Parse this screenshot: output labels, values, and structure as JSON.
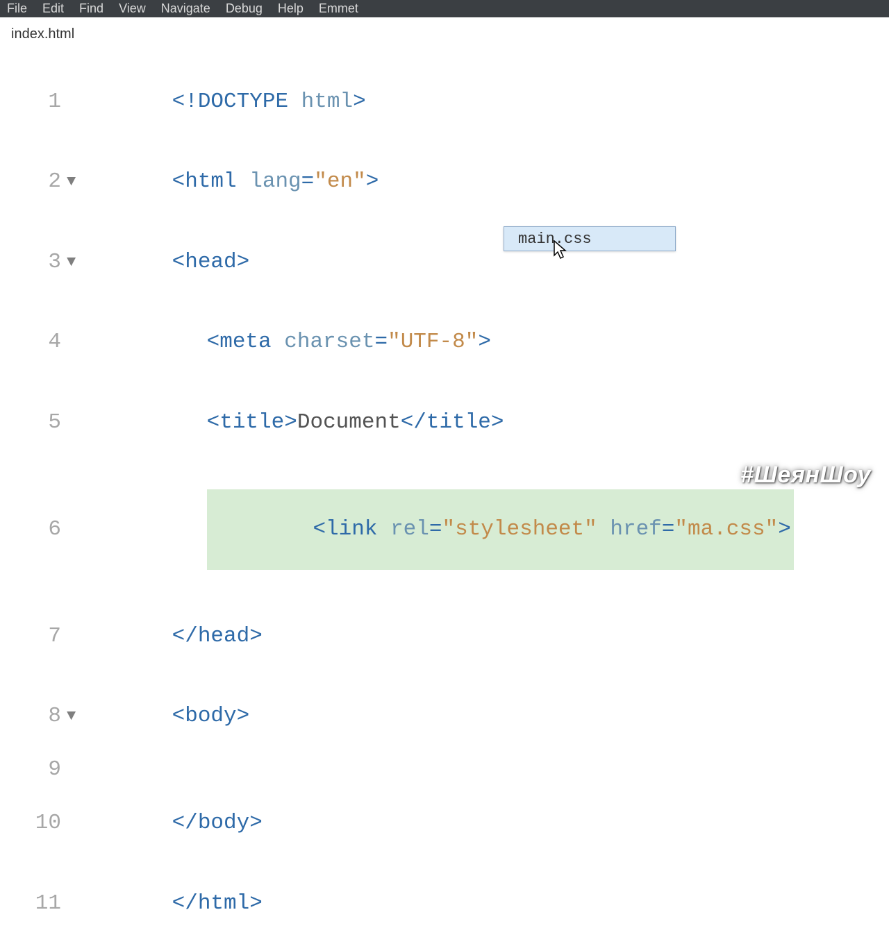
{
  "menubar": {
    "items": [
      "File",
      "Edit",
      "Find",
      "View",
      "Navigate",
      "Debug",
      "Help",
      "Emmet"
    ]
  },
  "tab": {
    "filename": "index.html"
  },
  "gutter": {
    "n1": "1",
    "n2": "2",
    "n3": "3",
    "n4": "4",
    "n5": "5",
    "n6": "6",
    "n7": "7",
    "n8": "8",
    "n9": "9",
    "n10": "10",
    "n11": "11"
  },
  "fold": {
    "caret": "▼"
  },
  "code": {
    "l1": {
      "a": "<!DOCTYPE",
      "b": " ",
      "c": "html",
      "d": ">"
    },
    "l2": {
      "a": "<html",
      "b": " ",
      "c": "lang",
      "d": "=",
      "e": "\"en\"",
      "f": ">"
    },
    "l3": {
      "a": "<head>",
      "b": ""
    },
    "l4": {
      "a": "<meta",
      "b": " ",
      "c": "charset",
      "d": "=",
      "e": "\"UTF-8\"",
      "f": ">"
    },
    "l5": {
      "a": "<title>",
      "b": "Document",
      "c": "</title>"
    },
    "l6": {
      "a": "<link",
      "b": " ",
      "c": "rel",
      "d": "=",
      "e": "\"stylesheet\"",
      "f": " ",
      "g": "href",
      "h": "=",
      "i": "\"ma.css\"",
      "j": ">"
    },
    "l7": {
      "a": "</head>"
    },
    "l8": {
      "a": "<body>"
    },
    "l10": {
      "a": "</body>"
    },
    "l11": {
      "a": "</html>"
    }
  },
  "autocomplete": {
    "item": "main.css"
  },
  "watermark": "#ШеянШоу"
}
